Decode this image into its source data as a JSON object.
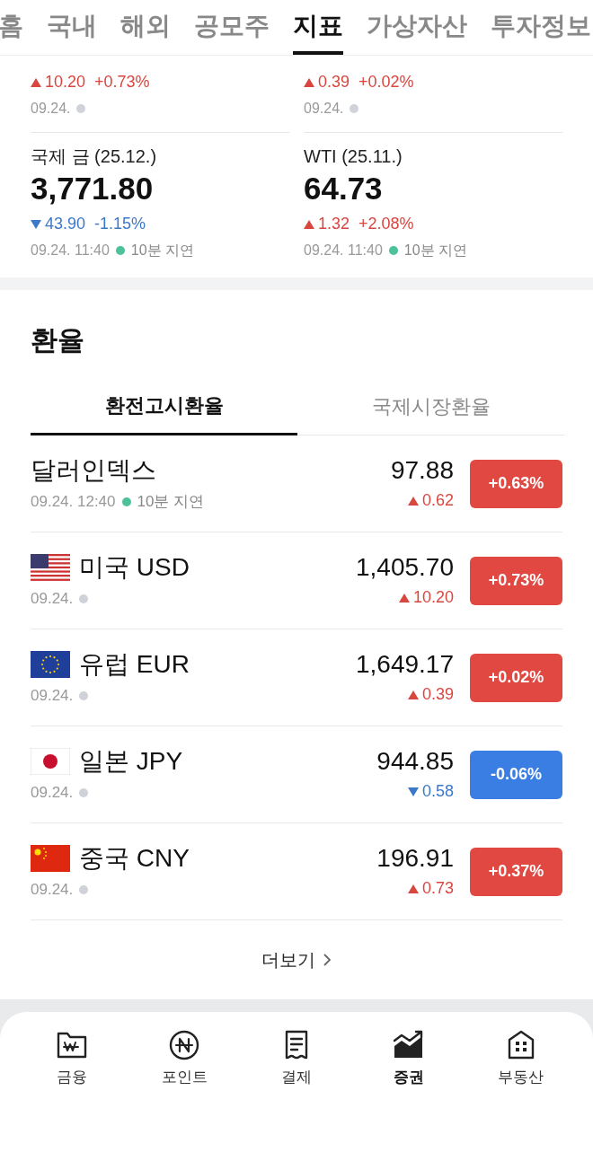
{
  "top_tabs": [
    {
      "label": "홈",
      "selected": false
    },
    {
      "label": "국내",
      "selected": false
    },
    {
      "label": "해외",
      "selected": false
    },
    {
      "label": "공모주",
      "selected": false
    },
    {
      "label": "지표",
      "selected": true
    },
    {
      "label": "가상자산",
      "selected": false
    },
    {
      "label": "투자정보",
      "selected": false
    }
  ],
  "indicator_rows": [
    [
      {
        "change": "10.20",
        "percent": "+0.73%",
        "rising": true,
        "time": "09.24.",
        "color": "#cfd2d8"
      },
      {
        "change": "0.39",
        "percent": "+0.02%",
        "rising": true,
        "time": "09.24.",
        "color": "#cfd2d8"
      }
    ],
    [
      {
        "name": "국제 금 (25.12.)",
        "value": "3,771.80",
        "change": "43.90",
        "percent": "-1.15%",
        "rising": false,
        "time": "09.24. 11:40",
        "color": "#4cc19a",
        "delay": "10분 지연"
      },
      {
        "name": "WTI (25.11.)",
        "value": "64.73",
        "change": "1.32",
        "percent": "+2.08%",
        "rising": true,
        "time": "09.24. 11:40",
        "color": "#4cc19a",
        "delay": "10분 지연"
      }
    ]
  ],
  "exchange": {
    "title": "환율",
    "tabs": [
      {
        "label": "환전고시환율",
        "selected": true
      },
      {
        "label": "국제시장환율",
        "selected": false
      }
    ],
    "rows": [
      {
        "kind": "none",
        "name": "달러인덱스",
        "time": "09.24. 12:40",
        "color": "#4cc19a",
        "delay": "10분 지연",
        "value": "97.88",
        "change": "0.62",
        "rising": true,
        "percent": "+0.63%"
      },
      {
        "kind": "us",
        "name": "미국 USD",
        "time": "09.24.",
        "color": "#cfd2d8",
        "value": "1,405.70",
        "change": "10.20",
        "rising": true,
        "percent": "+0.73%"
      },
      {
        "kind": "eu",
        "name": "유럽 EUR",
        "time": "09.24.",
        "color": "#cfd2d8",
        "value": "1,649.17",
        "change": "0.39",
        "rising": true,
        "percent": "+0.02%"
      },
      {
        "kind": "jp",
        "name": "일본 JPY",
        "time": "09.24.",
        "color": "#cfd2d8",
        "value": "944.85",
        "change": "0.58",
        "rising": false,
        "percent": "-0.06%"
      },
      {
        "kind": "cn",
        "name": "중국 CNY",
        "time": "09.24.",
        "color": "#cfd2d8",
        "value": "196.91",
        "change": "0.73",
        "rising": true,
        "percent": "+0.37%"
      }
    ],
    "more": "더보기"
  },
  "bottom_nav": [
    {
      "kind": "finance",
      "label": "금융",
      "selected": false
    },
    {
      "kind": "point",
      "label": "포인트",
      "selected": false
    },
    {
      "kind": "payment",
      "label": "결제",
      "selected": false
    },
    {
      "kind": "stock",
      "label": "증권",
      "selected": true
    },
    {
      "kind": "realestate",
      "label": "부동산",
      "selected": false
    }
  ]
}
